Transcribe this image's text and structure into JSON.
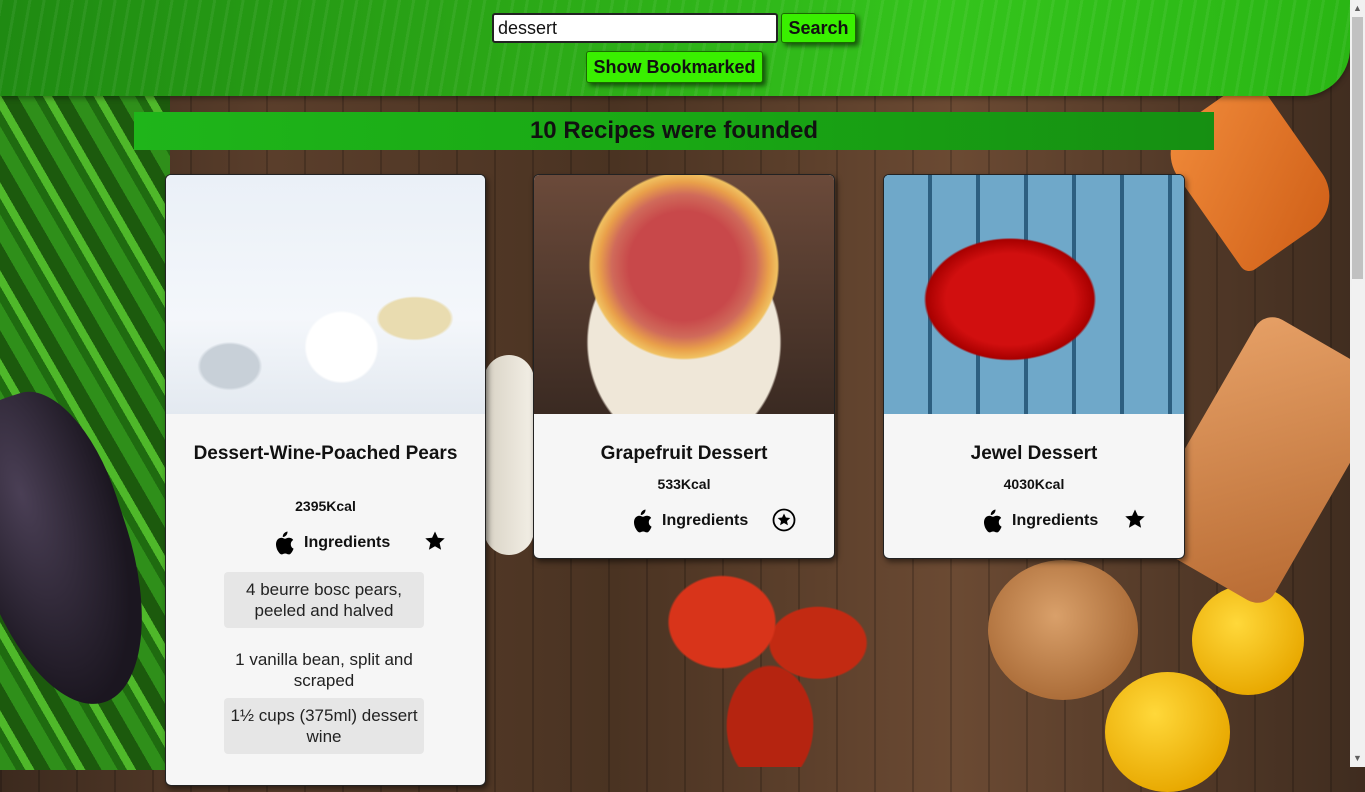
{
  "search": {
    "value": "dessert",
    "button_label": "Search"
  },
  "bookmark_button_label": "Show Bookmarked",
  "results_banner": "10 Recipes were founded",
  "recipes": [
    {
      "title": "Dessert-Wine-Poached Pears",
      "kcal": "2395Kcal",
      "ingredients_label": "Ingredients",
      "bookmarked": false,
      "ingredients": [
        "4 beurre bosc pears, peeled and halved",
        "1 vanilla bean, split and scraped",
        "1½ cups (375ml) dessert wine"
      ]
    },
    {
      "title": "Grapefruit Dessert",
      "kcal": "533Kcal",
      "ingredients_label": "Ingredients",
      "bookmarked": true
    },
    {
      "title": "Jewel Dessert",
      "kcal": "4030Kcal",
      "ingredients_label": "Ingredients",
      "bookmarked": false
    }
  ],
  "icons": {
    "ingredients": "apple-icon",
    "bookmark": "star-icon"
  },
  "colors": {
    "header_green": "#2aa516",
    "button_green": "#39f000",
    "banner_green": "#19a814"
  }
}
